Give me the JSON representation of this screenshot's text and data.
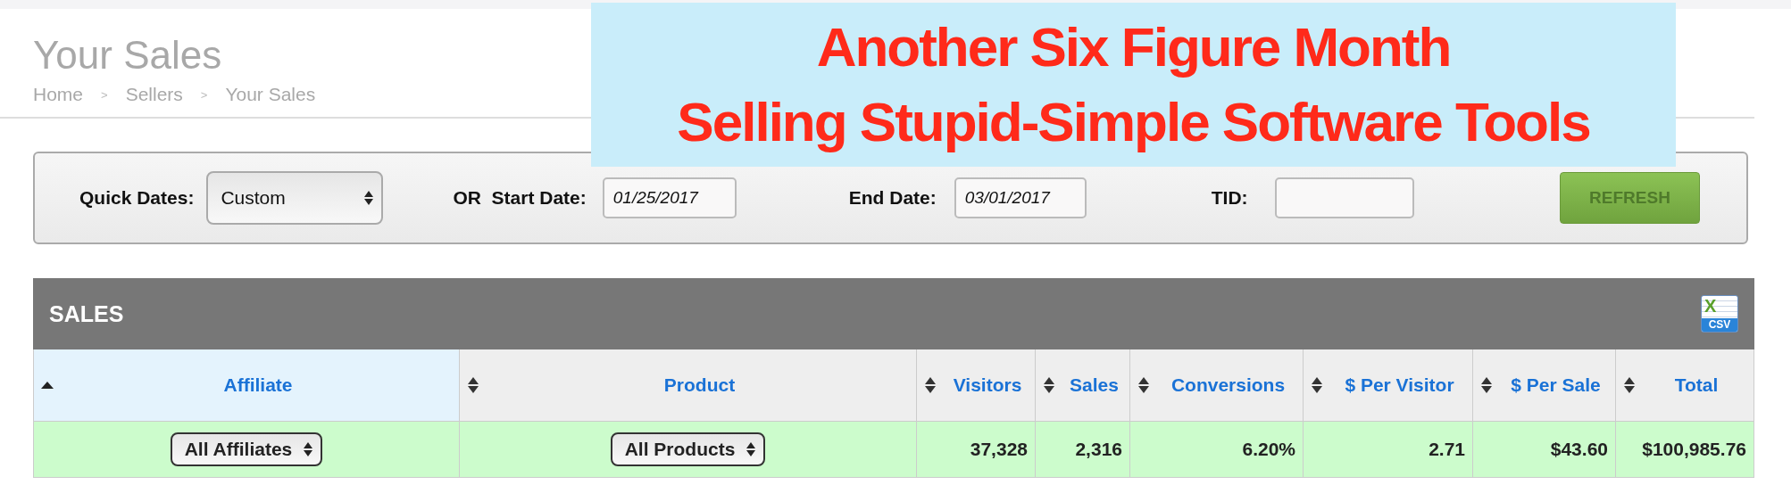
{
  "page": {
    "title": "Your Sales",
    "breadcrumbs": [
      "Home",
      "Sellers",
      "Your Sales"
    ],
    "separator": ">"
  },
  "banner": {
    "lines": [
      "Another Six Figure Month",
      "Selling Stupid-Simple Software Tools"
    ]
  },
  "filters": {
    "quick_dates": {
      "label": "Quick Dates:",
      "value": "Custom"
    },
    "start_date": {
      "label": "OR  Start Date:",
      "value": "01/25/2017"
    },
    "end_date": {
      "label": "End Date:",
      "value": "03/01/2017"
    },
    "tid": {
      "label": "TID:"
    },
    "refresh_button": "REFRESH"
  },
  "sales": {
    "title": "SALES",
    "export": {
      "letter": "X",
      "label": "CSV"
    },
    "columns": [
      {
        "label": "Affiliate",
        "sorted": true
      },
      {
        "label": "Product",
        "sorted": false
      },
      {
        "label": "Visitors",
        "sorted": false
      },
      {
        "label": "Sales",
        "sorted": false
      },
      {
        "label": "Conversions",
        "sorted": false
      },
      {
        "label": "$ Per Visitor",
        "sorted": false
      },
      {
        "label": "$ Per Sale",
        "sorted": false
      },
      {
        "label": "Total",
        "sorted": false
      }
    ],
    "rows": [
      {
        "cells": [
          {
            "kind": "select",
            "value": "All Affiliates"
          },
          {
            "kind": "select",
            "value": "All Products"
          },
          {
            "kind": "text",
            "value": "37,328"
          },
          {
            "kind": "text",
            "value": "2,316"
          },
          {
            "kind": "text",
            "value": "6.20%"
          },
          {
            "kind": "text",
            "value": "2.71"
          },
          {
            "kind": "text",
            "value": "$43.60"
          },
          {
            "kind": "text",
            "value": "$100,985.76"
          }
        ]
      }
    ]
  }
}
